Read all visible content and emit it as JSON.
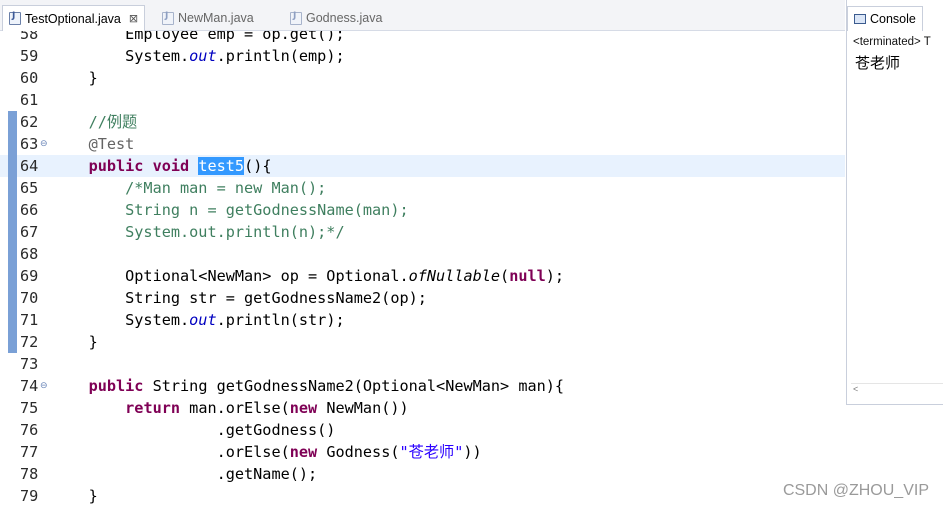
{
  "editor": {
    "tabs": [
      {
        "label": "TestOptional.java",
        "active": true,
        "closable": true
      },
      {
        "label": "NewMan.java",
        "active": false
      },
      {
        "label": "Godness.java",
        "active": false
      }
    ],
    "selected_text": "test5",
    "lines": [
      {
        "n": "58",
        "parts": [
          [
            "p",
            "        Employee emp = op.get();"
          ]
        ]
      },
      {
        "n": "59",
        "parts": [
          [
            "p",
            "        System."
          ],
          [
            "field",
            "out"
          ],
          [
            "p",
            ".println(emp);"
          ]
        ]
      },
      {
        "n": "60",
        "parts": [
          [
            "p",
            "    }"
          ]
        ]
      },
      {
        "n": "61",
        "parts": []
      },
      {
        "n": "62",
        "mark": true,
        "parts": [
          [
            "cm",
            "    //例题"
          ]
        ]
      },
      {
        "n": "63",
        "mark": true,
        "fold": true,
        "parts": [
          [
            "an",
            "    @Test"
          ]
        ]
      },
      {
        "n": "64",
        "mark": true,
        "current": true,
        "parts": [
          [
            "p",
            "    "
          ],
          [
            "kw",
            "public"
          ],
          [
            "p",
            " "
          ],
          [
            "kw",
            "void"
          ],
          [
            "p",
            " "
          ],
          [
            "sel",
            "test5"
          ],
          [
            "p",
            "(){"
          ]
        ]
      },
      {
        "n": "65",
        "mark": true,
        "parts": [
          [
            "cm",
            "        /*Man man = new Man();"
          ]
        ]
      },
      {
        "n": "66",
        "mark": true,
        "parts": [
          [
            "cm",
            "        String n = getGodnessName(man);"
          ]
        ]
      },
      {
        "n": "67",
        "mark": true,
        "parts": [
          [
            "cm",
            "        System.out.println(n);*/"
          ]
        ]
      },
      {
        "n": "68",
        "mark": true,
        "parts": []
      },
      {
        "n": "69",
        "mark": true,
        "parts": [
          [
            "p",
            "        Optional<NewMan> op = Optional."
          ],
          [
            "it",
            "ofNullable"
          ],
          [
            "p",
            "("
          ],
          [
            "kw",
            "null"
          ],
          [
            "p",
            ");"
          ]
        ]
      },
      {
        "n": "70",
        "mark": true,
        "parts": [
          [
            "p",
            "        String str = getGodnessName2(op);"
          ]
        ]
      },
      {
        "n": "71",
        "mark": true,
        "parts": [
          [
            "p",
            "        System."
          ],
          [
            "field",
            "out"
          ],
          [
            "p",
            ".println(str);"
          ]
        ]
      },
      {
        "n": "72",
        "mark": true,
        "parts": [
          [
            "p",
            "    }"
          ]
        ]
      },
      {
        "n": "73",
        "parts": []
      },
      {
        "n": "74",
        "fold": true,
        "parts": [
          [
            "p",
            "    "
          ],
          [
            "kw",
            "public"
          ],
          [
            "p",
            " String getGodnessName2(Optional<NewMan> man){"
          ]
        ]
      },
      {
        "n": "75",
        "parts": [
          [
            "p",
            "        "
          ],
          [
            "kw",
            "return"
          ],
          [
            "p",
            " man.orElse("
          ],
          [
            "kw",
            "new"
          ],
          [
            "p",
            " NewMan())"
          ]
        ]
      },
      {
        "n": "76",
        "parts": [
          [
            "p",
            "                  .getGodness()"
          ]
        ]
      },
      {
        "n": "77",
        "parts": [
          [
            "p",
            "                  .orElse("
          ],
          [
            "kw",
            "new"
          ],
          [
            "p",
            " Godness("
          ],
          [
            "st",
            "\"苍老师\""
          ],
          [
            "p",
            "))"
          ]
        ]
      },
      {
        "n": "78",
        "parts": [
          [
            "p",
            "                  .getName();"
          ]
        ]
      },
      {
        "n": "79",
        "parts": [
          [
            "p",
            "    }"
          ]
        ]
      }
    ]
  },
  "console": {
    "title": "Console",
    "status": "<terminated> T",
    "output": "苍老师"
  },
  "watermark": "CSDN @ZHOU_VIP",
  "colors": {
    "keyword": "#7f0055",
    "comment": "#3f7f5f",
    "string": "#2a00ff",
    "selection": "#3399ff",
    "current_line": "#e8f2fe"
  },
  "icons": [
    "java-file-icon",
    "close-icon",
    "console-icon",
    "fold-icon"
  ]
}
